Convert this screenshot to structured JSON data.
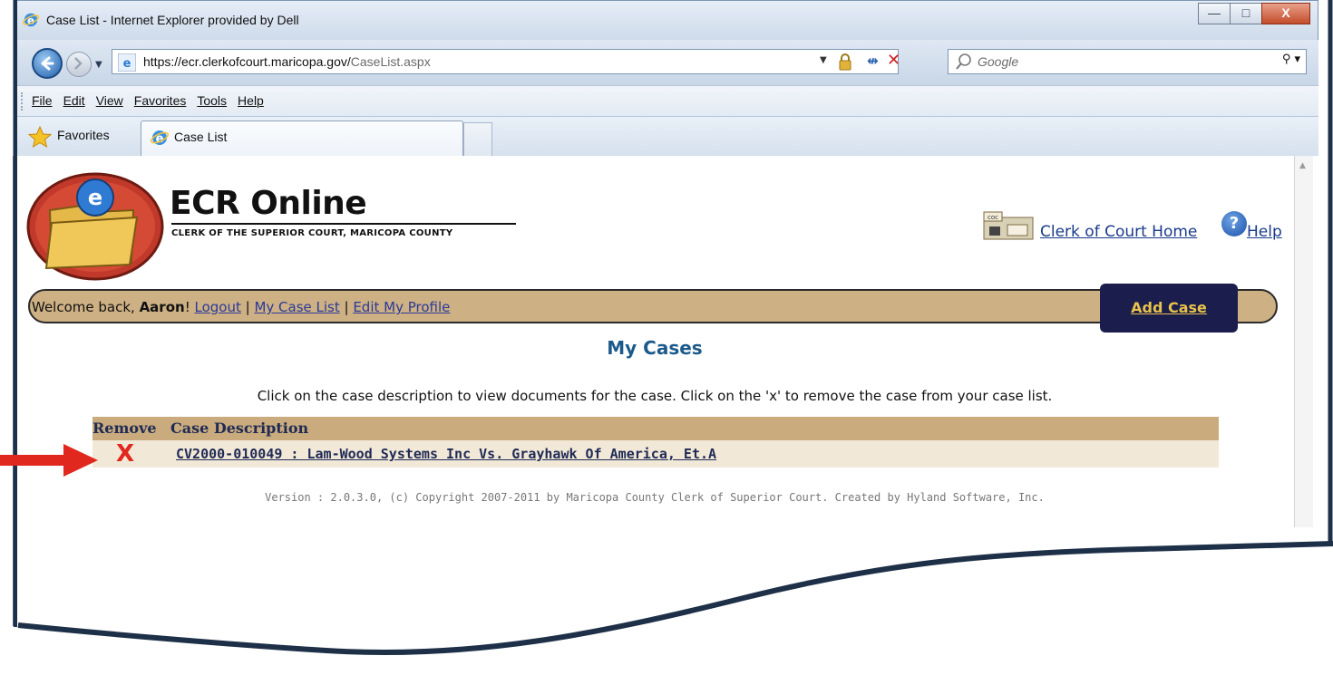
{
  "browser": {
    "window_title": "Case List - Internet Explorer provided by Dell",
    "window_buttons": {
      "minimize": "—",
      "maximize": "□",
      "close": "X"
    },
    "url_host": "https://ecr.clerkofcourt.maricopa.gov/",
    "url_path": "CaseList.aspx",
    "search_placeholder": "Google",
    "menu": [
      "File",
      "Edit",
      "View",
      "Favorites",
      "Tools",
      "Help"
    ],
    "favorites_label": "Favorites",
    "tab_label": "Case List"
  },
  "site": {
    "app_title": "ECR Online",
    "app_subtitle": "CLERK OF THE SUPERIOR COURT, MARICOPA COUNTY",
    "coc_link": "Clerk of Court Home",
    "help_link": "Help",
    "welcome_prefix": "Welcome back, ",
    "user_name": "Aaron",
    "welcome_suffix": "! ",
    "logout_link": "Logout",
    "separator": " | ",
    "my_case_list_link": "My Case List",
    "edit_profile_link": "Edit My Profile",
    "add_case_label": "Add Case",
    "page_heading": "My Cases",
    "instructions": "Click on the case description to view documents for the case. Click on the 'x' to remove the case from your case list.",
    "table_headers": {
      "remove": "Remove",
      "description": "Case Description"
    },
    "cases": [
      {
        "remove_symbol": "X",
        "description": "CV2000-010049 : Lam-Wood Systems Inc Vs. Grayhawk Of America, Et.A"
      }
    ],
    "version_text": "Version : 2.0.3.0, (c) Copyright 2007-2011 by Maricopa County Clerk of Superior Court. Created by Hyland Software, Inc."
  },
  "colors": {
    "nav_bar": "#cdb083",
    "add_case_bg": "#1b1d4d",
    "add_case_text": "#e8c24a",
    "heading": "#1c5a8c",
    "remove_x": "#e0281e",
    "callout_arrow": "#e0281e"
  }
}
